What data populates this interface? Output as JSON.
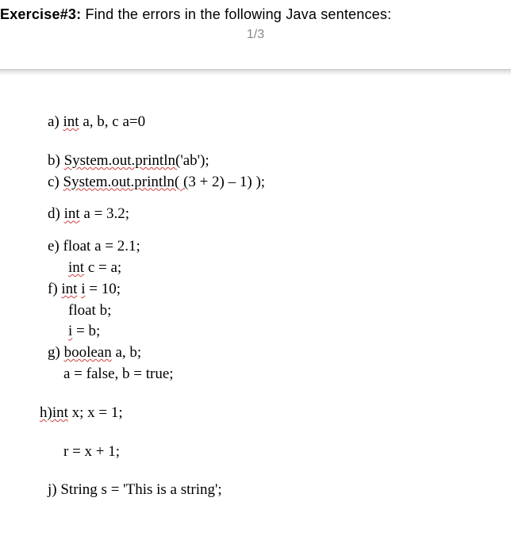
{
  "header": {
    "exercise_label": "Exercise#3:",
    "title_text": " Find the errors in the following Java sentences:",
    "page_indicator": "1/3"
  },
  "lines": {
    "a_label": "a) ",
    "a_sq": "int",
    "a_rest": " a, b, c a=0",
    "b_label": "b) ",
    "b_sq": "System.out.println(",
    "b_rest": "'ab');",
    "c_label": "c) ",
    "c_sq": "System.out.println( (",
    "c_rest": "3 + 2) – 1) );",
    "d_label": "d) ",
    "d_sq": "int",
    "d_rest": " a = 3.2;",
    "e_label": "e) float a = 2.1;",
    "e2_sq": "int",
    "e2_rest": " c = a;",
    "f_label": "f) ",
    "f_sq1": "int",
    "f_mid": " ",
    "f_sq2": "i",
    "f_rest": " = 10;",
    "f2": "float b;",
    "f3_sq": "i",
    "f3_rest": " = b;",
    "g_label": "g) ",
    "g_sq": "boolean",
    "g_rest": " a, b;",
    "g2": "a = false, b = true;",
    "h_sq": "h)int",
    "h_rest": " x; x = 1;",
    "h2": "r = x + 1;",
    "j_label": "j) String s = 'This is a string';"
  }
}
